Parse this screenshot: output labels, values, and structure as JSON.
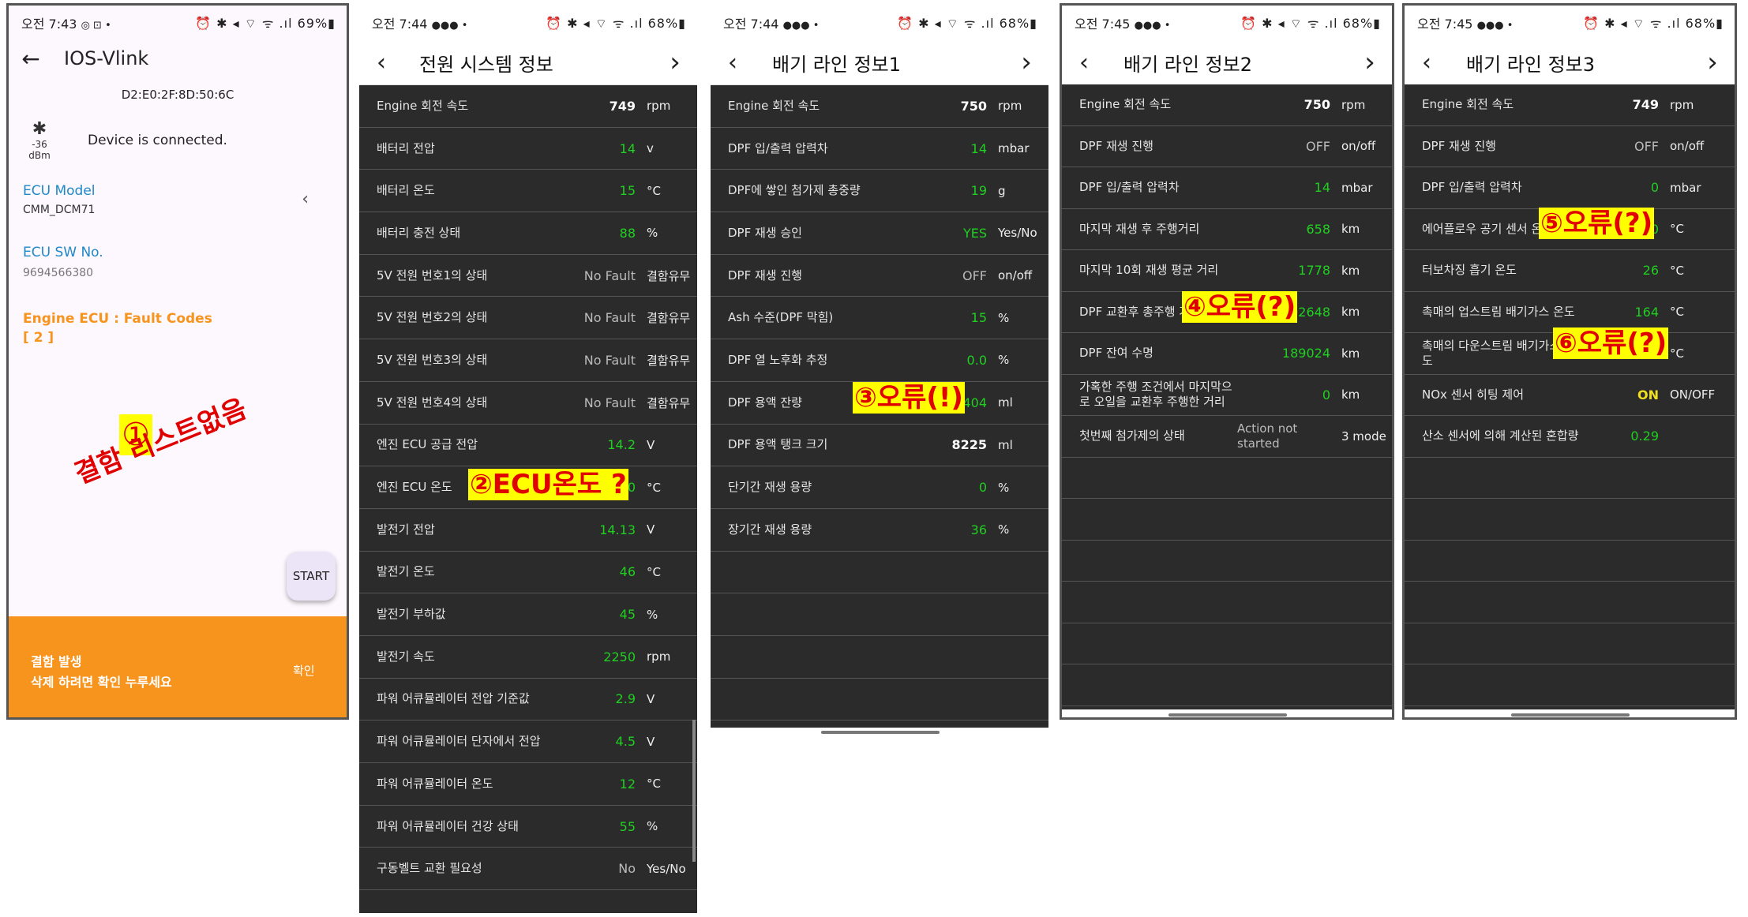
{
  "phone1": {
    "status_time": "오전 7:43",
    "status_icons": "◎ ⊡ •",
    "status_right": "⏰ ✱ ◂ ⌔ ᯤ .ıl 69%▮",
    "title": "IOS-Vlink",
    "mac": "D2:E0:2F:8D:50:6C",
    "signal": "-36 dBm",
    "connection": "Device is connected.",
    "ecu_model_label": "ECU Model",
    "ecu_model_value": "CMM_DCM71",
    "ecu_sw_label": "ECU SW No.",
    "ecu_sw_value": "9694566380",
    "fault_title": "Engine ECU : Fault Codes",
    "fault_count": "[ 2 ]",
    "start_button": "START",
    "banner_line1": "결함 발생",
    "banner_line2": "삭제 하려면 확인 누루세요",
    "banner_confirm": "확인",
    "note_num": "①",
    "note_text": "결함 리스트없음"
  },
  "phone2": {
    "status_time": "오전 7:44",
    "status_right": "⏰ ✱ ◂ ⌔ ᯤ .ıl 68%▮",
    "title": "전원 시스템 정보",
    "rows": [
      {
        "label": "Engine 회전 속도",
        "value": "749",
        "unit": "rpm",
        "cls": "w"
      },
      {
        "label": "배터리 전압",
        "value": "14",
        "unit": "v",
        "cls": "g"
      },
      {
        "label": "배터리 온도",
        "value": "15",
        "unit": "°C",
        "cls": "g"
      },
      {
        "label": "배터리 충전 상태",
        "value": "88",
        "unit": "%",
        "cls": "g"
      },
      {
        "label": "5V 전원 번호1의 상태",
        "value": "No Fault",
        "unit": "결함유무",
        "cls": "gray"
      },
      {
        "label": "5V 전원 번호2의 상태",
        "value": "No Fault",
        "unit": "결함유무",
        "cls": "gray"
      },
      {
        "label": "5V 전원 번호3의 상태",
        "value": "No Fault",
        "unit": "결함유무",
        "cls": "gray"
      },
      {
        "label": "5V 전원 번호4의 상태",
        "value": "No Fault",
        "unit": "결함유무",
        "cls": "gray"
      },
      {
        "label": "엔진 ECU 공급 전압",
        "value": "14.2",
        "unit": "V",
        "cls": "g"
      },
      {
        "label": "엔진 ECU 온도",
        "value": "0",
        "unit": "°C",
        "cls": "g"
      },
      {
        "label": "발전기 전압",
        "value": "14.13",
        "unit": "V",
        "cls": "g"
      },
      {
        "label": "발전기 온도",
        "value": "46",
        "unit": "°C",
        "cls": "g"
      },
      {
        "label": "발전기 부하값",
        "value": "45",
        "unit": "%",
        "cls": "g"
      },
      {
        "label": "발전기 속도",
        "value": "2250",
        "unit": "rpm",
        "cls": "g"
      },
      {
        "label": "파워 어큐뮬레이터 전압 기준값",
        "value": "2.9",
        "unit": "V",
        "cls": "g"
      },
      {
        "label": "파워 어큐뮬레이터 단자에서 전압",
        "value": "4.5",
        "unit": "V",
        "cls": "g"
      },
      {
        "label": "파워 어큐뮬레이터 온도",
        "value": "12",
        "unit": "°C",
        "cls": "g"
      },
      {
        "label": "파워 어큐뮬레이터 건강 상태",
        "value": "55",
        "unit": "%",
        "cls": "g"
      },
      {
        "label": "구동벨트 교환 필요성",
        "value": "No",
        "unit": "Yes/No",
        "cls": "gray"
      }
    ],
    "note": "②ECU온도 ?"
  },
  "phone3": {
    "status_time": "오전 7:44",
    "status_right": "⏰ ✱ ◂ ⌔ ᯤ .ıl 68%▮",
    "title": "배기 라인 정보1",
    "rows": [
      {
        "label": "Engine 회전 속도",
        "value": "750",
        "unit": "rpm",
        "cls": "w"
      },
      {
        "label": "DPF 입/출력 압력차",
        "value": "14",
        "unit": "mbar",
        "cls": "g"
      },
      {
        "label": "DPF에 쌓인 첨가제 총중량",
        "value": "19",
        "unit": "g",
        "cls": "g"
      },
      {
        "label": "DPF 재생 승인",
        "value": "YES",
        "unit": "Yes/No",
        "cls": "g"
      },
      {
        "label": "DPF 재생 진행",
        "value": "OFF",
        "unit": "on/off",
        "cls": "gray"
      },
      {
        "label": "Ash 수준(DPF 막힘)",
        "value": "15",
        "unit": "%",
        "cls": "g"
      },
      {
        "label": "DPF 열 노후화 추정",
        "value": "0.0",
        "unit": "%",
        "cls": "g"
      },
      {
        "label": "DPF 용액 잔량",
        "value": "-404",
        "unit": "ml",
        "cls": "g"
      },
      {
        "label": "DPF 용액 탱크 크기",
        "value": "8225",
        "unit": "ml",
        "cls": "w"
      },
      {
        "label": "단기간 재생 용량",
        "value": "0",
        "unit": "%",
        "cls": "g"
      },
      {
        "label": "장기간 재생 용량",
        "value": "36",
        "unit": "%",
        "cls": "g"
      }
    ],
    "note": "③오류(!)"
  },
  "phone4": {
    "status_time": "오전 7:45",
    "status_right": "⏰ ✱ ◂ ⌔ ᯤ .ıl 68%▮",
    "title": "배기 라인 정보2",
    "rows": [
      {
        "label": "Engine 회전 속도",
        "value": "750",
        "unit": "rpm",
        "cls": "w"
      },
      {
        "label": "DPF 재생 진행",
        "value": "OFF",
        "unit": "on/off",
        "cls": "gray"
      },
      {
        "label": "DPF 입/출력 압력차",
        "value": "14",
        "unit": "mbar",
        "cls": "g"
      },
      {
        "label": "마지막 재생 후 주행거리",
        "value": "658",
        "unit": "km",
        "cls": "g"
      },
      {
        "label": "마지막 10회 재생 평균 거리",
        "value": "1778",
        "unit": "km",
        "cls": "g"
      },
      {
        "label": "DPF 교환후 총주행 거리",
        "value": "402648",
        "unit": "km",
        "cls": "g"
      },
      {
        "label": "DPF 잔여 수명",
        "value": "189024",
        "unit": "km",
        "cls": "g"
      },
      {
        "label": "가혹한 주행 조건에서 마지막으로 오일을 교환후 주행한 거리",
        "value": "0",
        "unit": "km",
        "cls": "g"
      },
      {
        "label": "첫번째 첨가제의 상태",
        "value": "Action not started",
        "unit": "3 mode",
        "cls": "gray"
      }
    ],
    "note": "④오류(?)"
  },
  "phone5": {
    "status_time": "오전 7:45",
    "status_right": "⏰ ✱ ◂ ⌔ ᯤ .ıl 68%▮",
    "title": "배기 라인 정보3",
    "rows": [
      {
        "label": "Engine 회전 속도",
        "value": "749",
        "unit": "rpm",
        "cls": "w"
      },
      {
        "label": "DPF 재생 진행",
        "value": "OFF",
        "unit": "on/off",
        "cls": "gray"
      },
      {
        "label": "DPF 입/출력 압력차",
        "value": "0",
        "unit": "mbar",
        "cls": "g"
      },
      {
        "label": "에어플로우 공기 센서 온도",
        "value": "1000",
        "unit": "°C",
        "cls": "g"
      },
      {
        "label": "터보차징 흡기 온도",
        "value": "26",
        "unit": "°C",
        "cls": "g"
      },
      {
        "label": "촉매의 업스트림 배기가스 온도",
        "value": "164",
        "unit": "°C",
        "cls": "g"
      },
      {
        "label": "촉매의 다운스트림 배기가스 온도",
        "value": "0",
        "unit": "°C",
        "cls": "g"
      },
      {
        "label": "NOx 센서 히팅 제어",
        "value": "ON",
        "unit": "ON/OFF",
        "cls": "y"
      },
      {
        "label": "산소 센서에 의해 계산된 혼합량",
        "value": "0.29",
        "unit": "",
        "cls": "g"
      }
    ],
    "note5": "⑤오류(?)",
    "note6": "⑥오류(?)"
  }
}
